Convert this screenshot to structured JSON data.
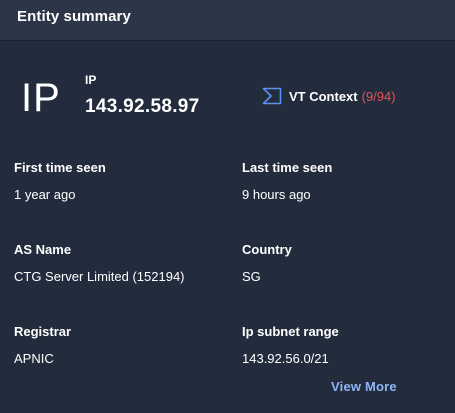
{
  "header": {
    "title": "Entity summary"
  },
  "entity": {
    "type_glyph": "IP",
    "type_label": "IP",
    "value": "143.92.58.97"
  },
  "vt_context": {
    "label": "VT Context",
    "count": "(9/94)",
    "icon": "virustotal-icon",
    "count_color": "#e4525a"
  },
  "fields": {
    "first_seen": {
      "label": "First time seen",
      "value": "1 year ago"
    },
    "last_seen": {
      "label": "Last time seen",
      "value": "9 hours ago"
    },
    "as_name": {
      "label": "AS Name",
      "value": "CTG Server Limited (152194)"
    },
    "country": {
      "label": "Country",
      "value": "SG"
    },
    "registrar": {
      "label": "Registrar",
      "value": "APNIC"
    },
    "subnet": {
      "label": "Ip subnet range",
      "value": "143.92.56.0/21"
    }
  },
  "actions": {
    "view_more": "View More"
  },
  "colors": {
    "background": "#232c3d",
    "header_background": "#2c3648",
    "link": "#8fb4f5",
    "vt_icon": "#5b8ff0"
  }
}
